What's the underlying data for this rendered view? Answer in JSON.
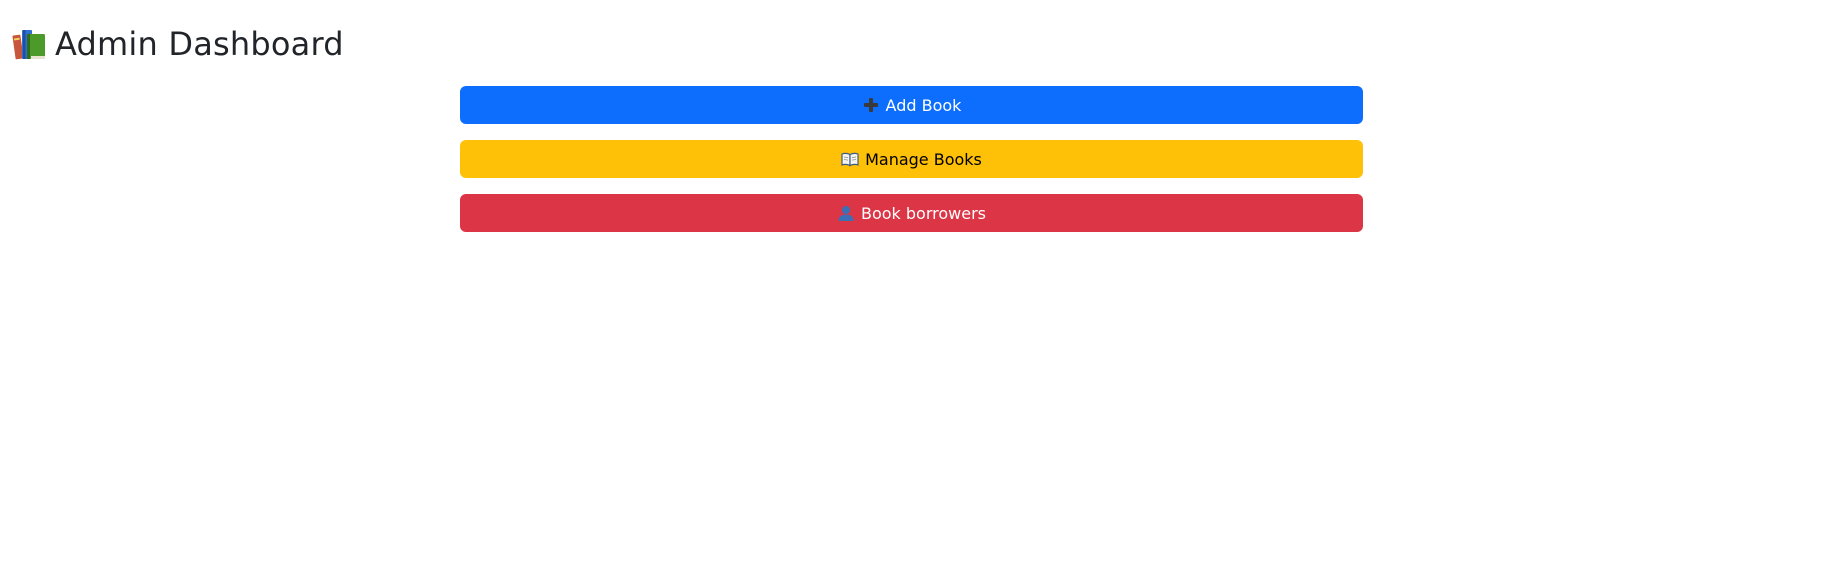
{
  "header": {
    "logo_icon": "books-icon",
    "title": "Admin Dashboard"
  },
  "actions": [
    {
      "label": "Add Book",
      "icon": "plus-icon",
      "color": "#0d6efd"
    },
    {
      "label": "Manage Books",
      "icon": "open-book-icon",
      "color": "#ffc107"
    },
    {
      "label": "Book borrowers",
      "icon": "user-icon",
      "color": "#dc3545"
    }
  ]
}
